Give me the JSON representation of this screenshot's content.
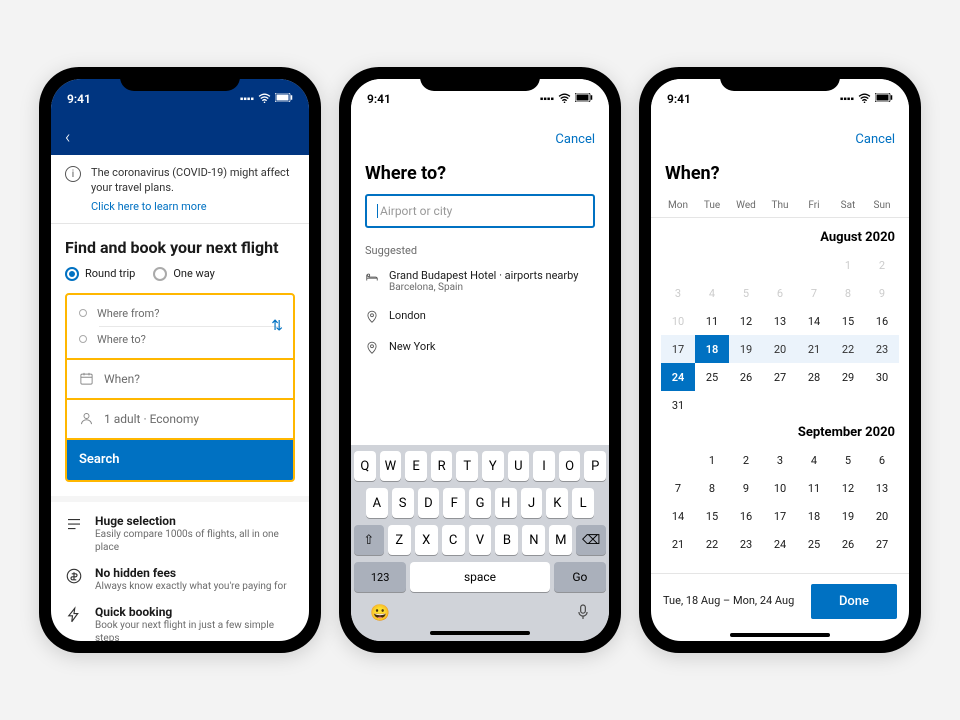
{
  "status_time": "9:41",
  "phone1": {
    "banner_text": "The coronavirus (COVID-19) might affect your travel plans.",
    "banner_link": "Click here to learn more",
    "heading": "Find and book your next flight",
    "trip_round": "Round trip",
    "trip_oneway": "One way",
    "from": "Where from?",
    "to": "Where to?",
    "when": "When?",
    "pax": "1 adult · Economy",
    "search": "Search",
    "feature1_title": "Huge selection",
    "feature1_desc": "Easily compare 1000s of flights, all in one place",
    "feature2_title": "No hidden fees",
    "feature2_desc": "Always know exactly what you're paying for",
    "feature3_title": "Quick booking",
    "feature3_desc": "Book your next flight in just a few simple steps"
  },
  "phone2": {
    "cancel": "Cancel",
    "title": "Where to?",
    "placeholder": "Airport or city",
    "suggested_label": "Suggested",
    "sugg1_title": "Grand Budapest Hotel · airports nearby",
    "sugg1_sub": "Barcelona, Spain",
    "sugg2": "London",
    "sugg3": "New York",
    "row1": [
      "Q",
      "W",
      "E",
      "R",
      "T",
      "Y",
      "U",
      "I",
      "O",
      "P"
    ],
    "row2": [
      "A",
      "S",
      "D",
      "F",
      "G",
      "H",
      "J",
      "K",
      "L"
    ],
    "row3": [
      "Z",
      "X",
      "C",
      "V",
      "B",
      "N",
      "M"
    ],
    "k123": "123",
    "space": "space",
    "go": "Go"
  },
  "phone3": {
    "cancel": "Cancel",
    "title": "When?",
    "dow": [
      "Mon",
      "Tue",
      "Wed",
      "Thu",
      "Fri",
      "Sat",
      "Sun"
    ],
    "month1": "August 2020",
    "month2": "September 2020",
    "aug_days": [
      {
        "n": "",
        "c": ""
      },
      {
        "n": "",
        "c": ""
      },
      {
        "n": "",
        "c": ""
      },
      {
        "n": "",
        "c": ""
      },
      {
        "n": "",
        "c": ""
      },
      {
        "n": "1",
        "c": "faded"
      },
      {
        "n": "2",
        "c": "faded"
      },
      {
        "n": "3",
        "c": "faded"
      },
      {
        "n": "4",
        "c": "faded"
      },
      {
        "n": "5",
        "c": "faded"
      },
      {
        "n": "6",
        "c": "faded"
      },
      {
        "n": "7",
        "c": "faded"
      },
      {
        "n": "8",
        "c": "faded"
      },
      {
        "n": "9",
        "c": "faded"
      },
      {
        "n": "10",
        "c": "faded"
      },
      {
        "n": "11",
        "c": ""
      },
      {
        "n": "12",
        "c": ""
      },
      {
        "n": "13",
        "c": ""
      },
      {
        "n": "14",
        "c": ""
      },
      {
        "n": "15",
        "c": ""
      },
      {
        "n": "16",
        "c": ""
      },
      {
        "n": "17",
        "c": "range"
      },
      {
        "n": "18",
        "c": "sel"
      },
      {
        "n": "19",
        "c": "range"
      },
      {
        "n": "20",
        "c": "range"
      },
      {
        "n": "21",
        "c": "range"
      },
      {
        "n": "22",
        "c": "range"
      },
      {
        "n": "23",
        "c": "range"
      },
      {
        "n": "24",
        "c": "sel"
      },
      {
        "n": "25",
        "c": ""
      },
      {
        "n": "26",
        "c": ""
      },
      {
        "n": "27",
        "c": ""
      },
      {
        "n": "28",
        "c": ""
      },
      {
        "n": "29",
        "c": ""
      },
      {
        "n": "30",
        "c": ""
      },
      {
        "n": "31",
        "c": ""
      }
    ],
    "sep_days": [
      {
        "n": "",
        "c": ""
      },
      {
        "n": "1",
        "c": ""
      },
      {
        "n": "2",
        "c": ""
      },
      {
        "n": "3",
        "c": ""
      },
      {
        "n": "4",
        "c": ""
      },
      {
        "n": "5",
        "c": ""
      },
      {
        "n": "6",
        "c": ""
      },
      {
        "n": "7",
        "c": ""
      },
      {
        "n": "8",
        "c": ""
      },
      {
        "n": "9",
        "c": ""
      },
      {
        "n": "10",
        "c": ""
      },
      {
        "n": "11",
        "c": ""
      },
      {
        "n": "12",
        "c": ""
      },
      {
        "n": "13",
        "c": ""
      },
      {
        "n": "14",
        "c": ""
      },
      {
        "n": "15",
        "c": ""
      },
      {
        "n": "16",
        "c": ""
      },
      {
        "n": "17",
        "c": ""
      },
      {
        "n": "18",
        "c": ""
      },
      {
        "n": "19",
        "c": ""
      },
      {
        "n": "20",
        "c": ""
      },
      {
        "n": "21",
        "c": ""
      },
      {
        "n": "22",
        "c": ""
      },
      {
        "n": "23",
        "c": ""
      },
      {
        "n": "24",
        "c": ""
      },
      {
        "n": "25",
        "c": ""
      },
      {
        "n": "26",
        "c": ""
      },
      {
        "n": "27",
        "c": ""
      }
    ],
    "range_text": "Tue, 18 Aug – Mon, 24 Aug",
    "done": "Done"
  }
}
